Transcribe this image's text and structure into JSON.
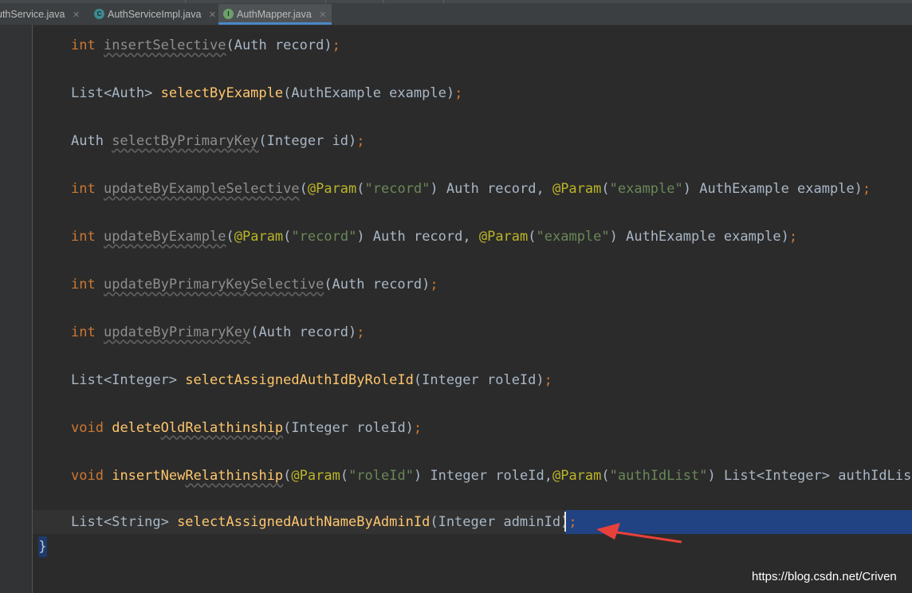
{
  "tabs": [
    {
      "label": "uthService.java",
      "icon": "class-icon",
      "closable": true
    },
    {
      "label": "AuthServiceImpl.java",
      "icon": "class-icon",
      "closable": true
    },
    {
      "label": "AuthMapper.java",
      "icon": "interface-icon",
      "closable": true,
      "active": true
    }
  ],
  "tab_icons": {
    "class": "C",
    "interface": "I"
  },
  "close_glyph": "✕",
  "colors": {
    "background": "#2b2b2b",
    "keyword": "#cc7832",
    "method": "#ffc66d",
    "string": "#6a8759",
    "annotation": "#bbb529",
    "selection": "#214283",
    "arrow": "#e8413b"
  },
  "code": {
    "lines": [
      {
        "a": "int",
        "b": " ",
        "c": "insertSelective",
        "d": "(Auth record)",
        "e": ";"
      },
      {
        "a": "List<Auth> ",
        "c": "selectByExample",
        "d": "(AuthExample example)",
        "e": ";"
      },
      {
        "a": "Auth ",
        "c": "selectByPrimaryKey",
        "d": "(Integer id)",
        "e": ";"
      },
      {
        "a": "int",
        "b": " ",
        "c": "updateByExampleSelective"
      },
      {
        "a": "int",
        "b": " ",
        "c": "updateByExample"
      },
      {
        "a": "int",
        "b": " ",
        "c": "updateByPrimaryKeySelective",
        "d": "(Auth record)",
        "e": ";"
      },
      {
        "a": "int",
        "b": " ",
        "c": "updateByPrimaryKey",
        "d": "(Auth record)",
        "e": ";"
      },
      {
        "a": "List<Integer> ",
        "c": "selectAssignedAuthIdByRoleId",
        "d": "(Integer roleId)",
        "e": ";"
      },
      {
        "a": "void",
        "b": " ",
        "c": "delete",
        "c2": "OldRelathinship",
        "d": "(Integer roleId)",
        "e": ";"
      },
      {
        "a": "void",
        "b": " ",
        "c": "insertNew",
        "c2": "Relathinship"
      },
      {
        "a": "List<String> ",
        "c": "selectAssignedAuthNameByAdminId",
        "d": "(Integer adminId)",
        "e": ";"
      }
    ],
    "param_annotation": "@Param",
    "line3_args": {
      "s1": "\"record\"",
      "t1": ") Auth record, ",
      "s2": "\"example\"",
      "t2": ") AuthExample example)",
      "e": ";"
    },
    "line4_args": {
      "s1": "\"record\"",
      "t1": ") Auth record, ",
      "s2": "\"example\"",
      "t2": ") AuthExample example)",
      "e": ";"
    },
    "line9_args": {
      "s1": "\"roleId\"",
      "t1": ") Integer roleId,",
      "s2": "\"authIdList\"",
      "t2": ") List<Integer> authIdList)",
      "e": ";"
    },
    "closing_brace": "}"
  },
  "watermark": "https://blog.csdn.net/Criven"
}
